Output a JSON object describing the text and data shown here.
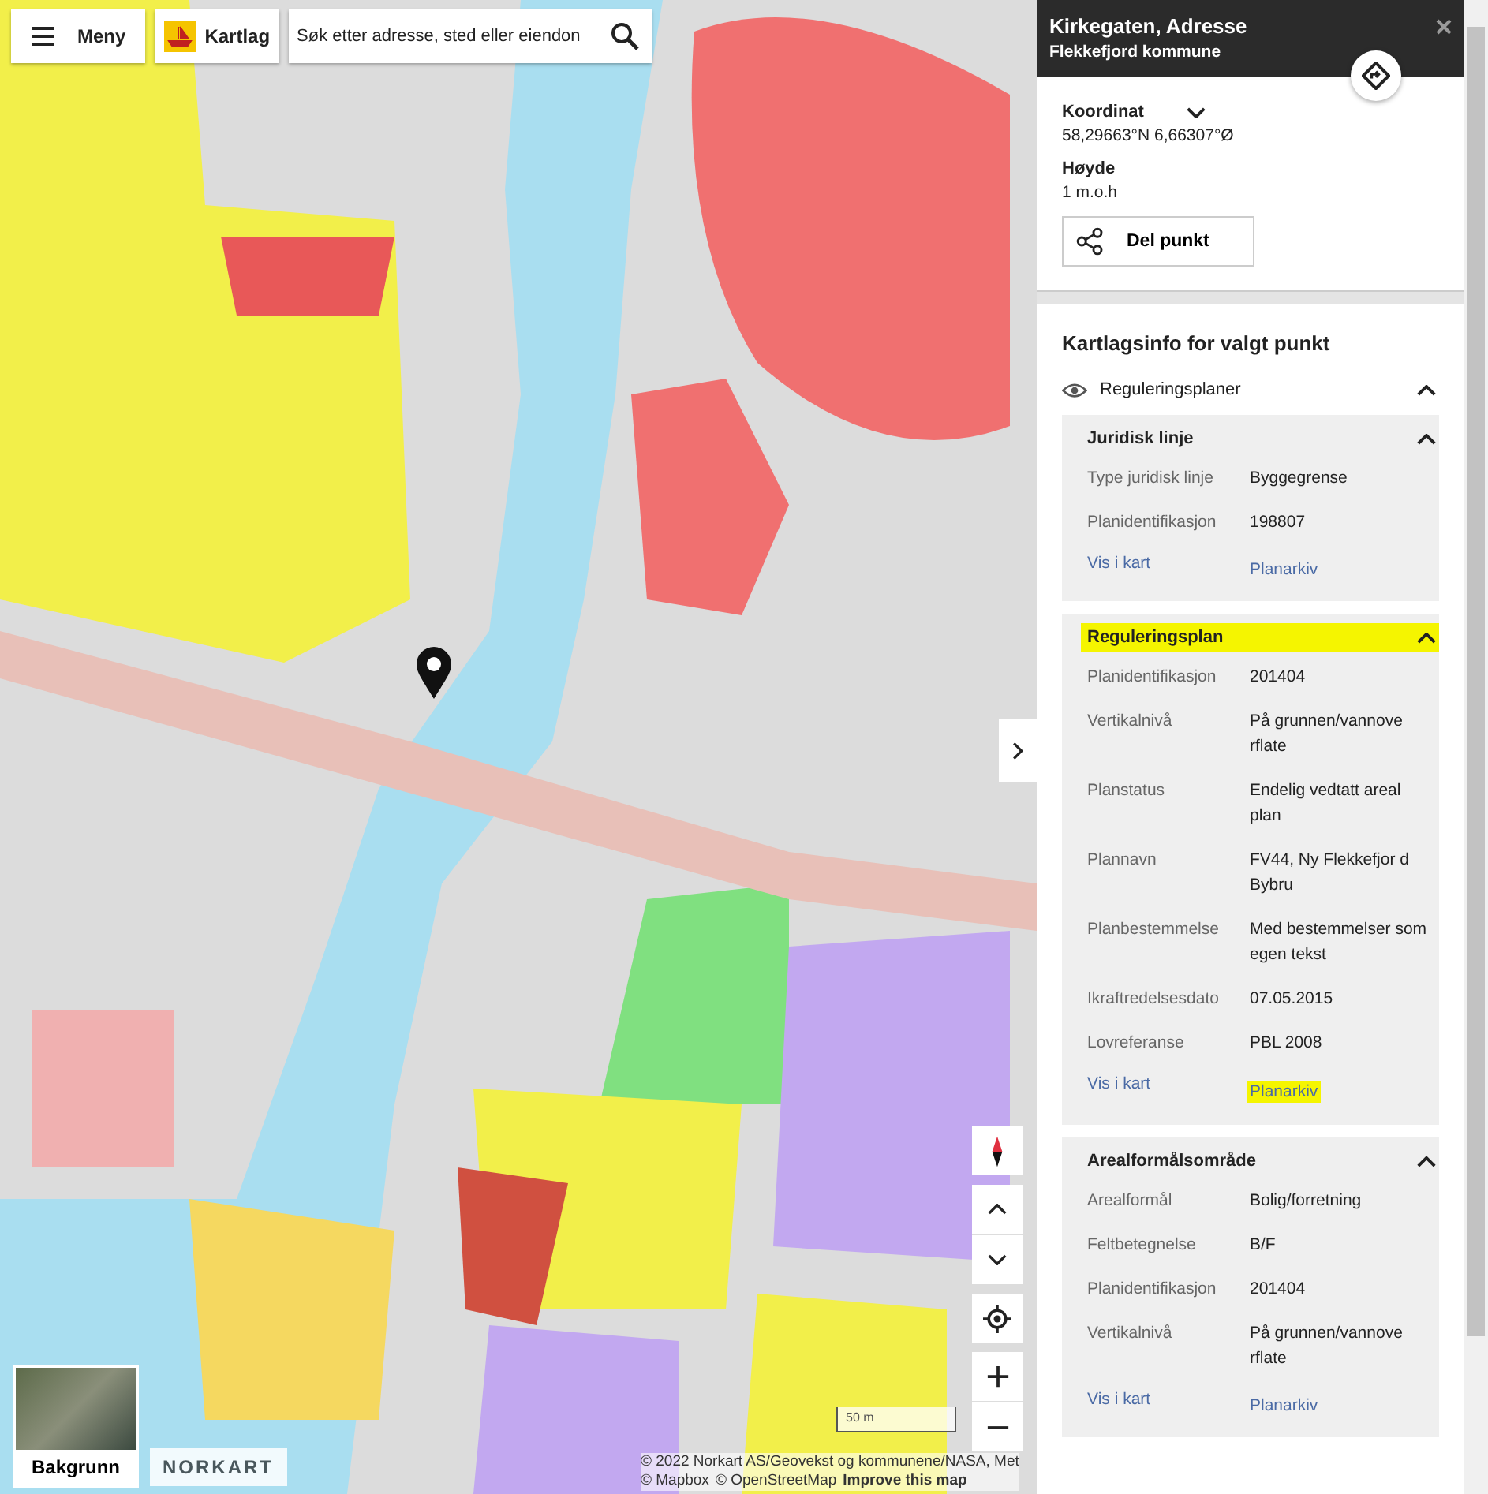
{
  "toolbar": {
    "menu_button": "Meny",
    "layers_button": "Kartlag",
    "search": {
      "placeholder": "Søk etter adresse, sted eller eiendon"
    }
  },
  "map": {
    "background_button": "Bakgrunn",
    "logo": "NORKART",
    "scale": "50 m",
    "attribution": [
      "© 2022 Norkart AS/Geovekst og kommunene/NASA, Met"
    ],
    "attribution_links": [
      "© Mapbox",
      "© OpenStreetMap",
      "Improve this map"
    ]
  },
  "panel": {
    "title": "Kirkegaten, Adresse",
    "subtitle": "Flekkefjord kommune",
    "details": [
      {
        "label": "Koordinat",
        "value": "58,29663°N 6,66307°Ø",
        "expandable": true
      },
      {
        "label": "Høyde",
        "value": "1 m.o.h",
        "expandable": false
      }
    ],
    "share_button": "Del punkt",
    "layer_info": {
      "title": "Kartlagsinfo for valgt punkt",
      "layer": {
        "label": "Reguleringsplaner",
        "expanded": true
      },
      "sections": [
        {
          "title": "Juridisk linje",
          "highlighted": false,
          "expanded": true,
          "rows": [
            {
              "label": "Type juridisk linje",
              "value": "Byggegrense"
            },
            {
              "label": "Planidentifikasjon",
              "value": "198807"
            }
          ],
          "links": [
            {
              "text": "Vis i kart",
              "highlighted": false
            },
            {
              "text": "Planarkiv",
              "highlighted": false
            }
          ]
        },
        {
          "title": "Reguleringsplan",
          "highlighted": true,
          "expanded": true,
          "rows": [
            {
              "label": "Planidentifikasjon",
              "value": "201404"
            },
            {
              "label": "Vertikalnivå",
              "value": "På grunnen/vannove rflate"
            },
            {
              "label": "Planstatus",
              "value": "Endelig vedtatt areal plan"
            },
            {
              "label": "Plannavn",
              "value": "FV44, Ny Flekkefjor d Bybru"
            },
            {
              "label": "Planbestemmelse",
              "value": "Med bestemmelser som egen tekst"
            },
            {
              "label": "Ikraftredelsesdato",
              "value": "07.05.2015"
            },
            {
              "label": "Lovreferanse",
              "value": "PBL 2008"
            }
          ],
          "links": [
            {
              "text": "Vis i kart",
              "highlighted": false
            },
            {
              "text": "Planarkiv",
              "highlighted": true
            }
          ]
        },
        {
          "title": "Arealformålsområde",
          "highlighted": false,
          "expanded": true,
          "rows": [
            {
              "label": "Arealformål",
              "value": "Bolig/forretning"
            },
            {
              "label": "Feltbetegnelse",
              "value": "B/F"
            },
            {
              "label": "Planidentifikasjon",
              "value": "201404"
            },
            {
              "label": "Vertikalnivå",
              "value": "På grunnen/vannove rflate"
            }
          ],
          "links": [
            {
              "text": "Vis i kart",
              "highlighted": false
            },
            {
              "text": "Planarkiv",
              "highlighted": false
            }
          ]
        }
      ]
    }
  }
}
